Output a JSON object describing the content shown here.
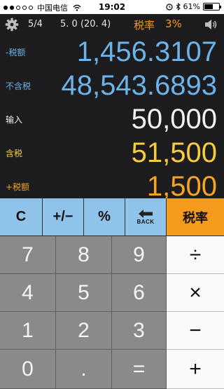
{
  "status_bar": {
    "carrier": "中国电信",
    "time": "19:02",
    "battery": "61%",
    "battery_level": 0.61
  },
  "header": {
    "page_indicator": "5/4",
    "rate_info": "5. 0 (20. 4)",
    "rate_label": "税率",
    "rate_value": "3%"
  },
  "rows": [
    {
      "label": "-税额",
      "value": "1,456.3107",
      "color": "#6bb3e8"
    },
    {
      "label": "不含税",
      "value": "48,543.6893",
      "color": "#6bb3e8"
    },
    {
      "label": "输入",
      "value": "50,000",
      "color": "#f2f2f2"
    },
    {
      "label": "含税",
      "value": "51,500",
      "color": "#f5cd3f"
    },
    {
      "label": "+税额",
      "value": "1,500",
      "color": "#f4a523"
    }
  ],
  "keypad": {
    "function_keys": {
      "clear": "C",
      "sign": "+/−",
      "percent": "%",
      "back": "BACK",
      "rate": "税率"
    },
    "digits": [
      "7",
      "8",
      "9",
      "4",
      "5",
      "6",
      "1",
      "2",
      "3",
      "0",
      "."
    ],
    "operators": {
      "divide": "÷",
      "multiply": "×",
      "subtract": "−",
      "add": "+",
      "equals": "="
    }
  },
  "colors": {
    "display_bg": "#1c1c1e",
    "accent_orange": "#f49a1c",
    "function_blue": "#8fc3ea",
    "digit_gray": "#8a8a8a"
  }
}
